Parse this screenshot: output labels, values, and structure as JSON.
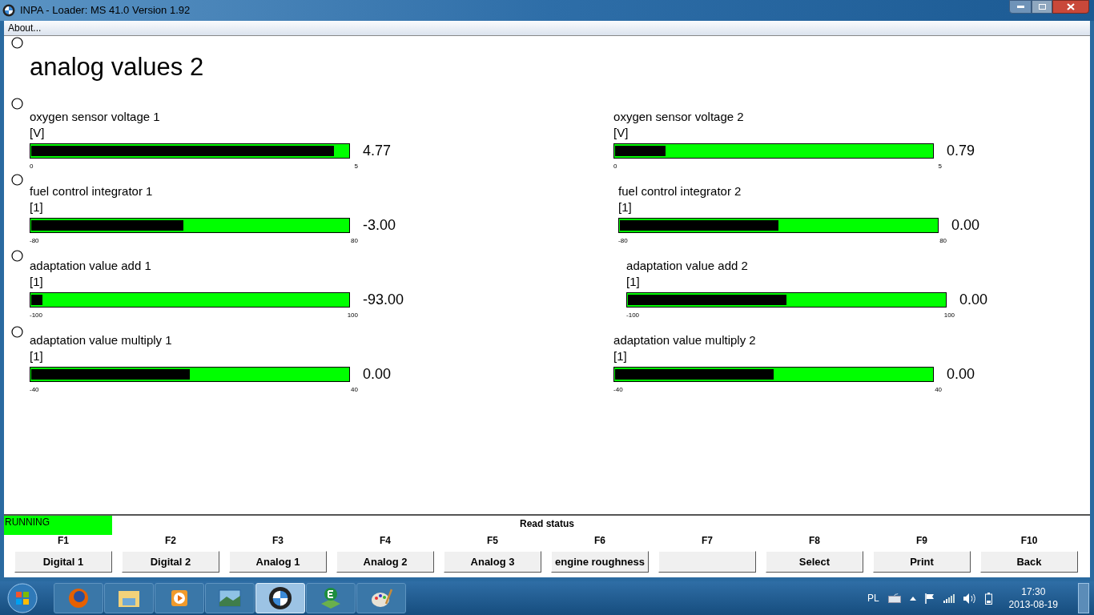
{
  "window": {
    "title": "INPA - Loader:  MS 41.0 Version 1.92"
  },
  "menu": [
    "About..."
  ],
  "heading": "analog values 2",
  "gauges": [
    {
      "name": "oxygen sensor voltage  1",
      "unit": "[V]",
      "min": "0",
      "max": "5",
      "value": "4.77",
      "level": 0.954
    },
    {
      "name": "oxygen sensor voltage  2",
      "unit": "[V]",
      "min": "0",
      "max": "5",
      "value": "0.79",
      "level": 0.158
    },
    {
      "name": "fuel control integrator 1",
      "unit": "[1]",
      "min": "-80",
      "max": "80",
      "value": "-3.00",
      "level": 0.481
    },
    {
      "name": "fuel control integrator 2",
      "unit": "[1]",
      "min": "-80",
      "max": "80",
      "value": "0.00",
      "level": 0.5
    },
    {
      "name": "adaptation value add 1",
      "unit": "[1]",
      "min": "-100",
      "max": "100",
      "value": "-93.00",
      "level": 0.035
    },
    {
      "name": "adaptation value add 2",
      "unit": "[1]",
      "min": "-100",
      "max": "100",
      "value": "0.00",
      "level": 0.5
    },
    {
      "name": "adaptation value multiply 1",
      "unit": "[1]",
      "min": "-40",
      "max": "40",
      "value": "0.00",
      "level": 0.5
    },
    {
      "name": "adaptation value multiply 2",
      "unit": "[1]",
      "min": "-40",
      "max": "40",
      "value": "0.00",
      "level": 0.5
    }
  ],
  "status": {
    "state": "RUNNING",
    "message": "Read status"
  },
  "function_keys": [
    {
      "key": "F1",
      "label": "Digital 1"
    },
    {
      "key": "F2",
      "label": "Digital 2"
    },
    {
      "key": "F3",
      "label": "Analog 1"
    },
    {
      "key": "F4",
      "label": "Analog 2"
    },
    {
      "key": "F5",
      "label": "Analog 3"
    },
    {
      "key": "F6",
      "label": "engine roughness"
    },
    {
      "key": "F7"
    },
    {
      "key": "F8",
      "label": "Select"
    },
    {
      "key": "F9",
      "label": "Print"
    },
    {
      "key": "F10",
      "label": "Back"
    }
  ],
  "taskbar": {
    "language": "PL",
    "time": "17:30",
    "date": "2013-08-19"
  }
}
